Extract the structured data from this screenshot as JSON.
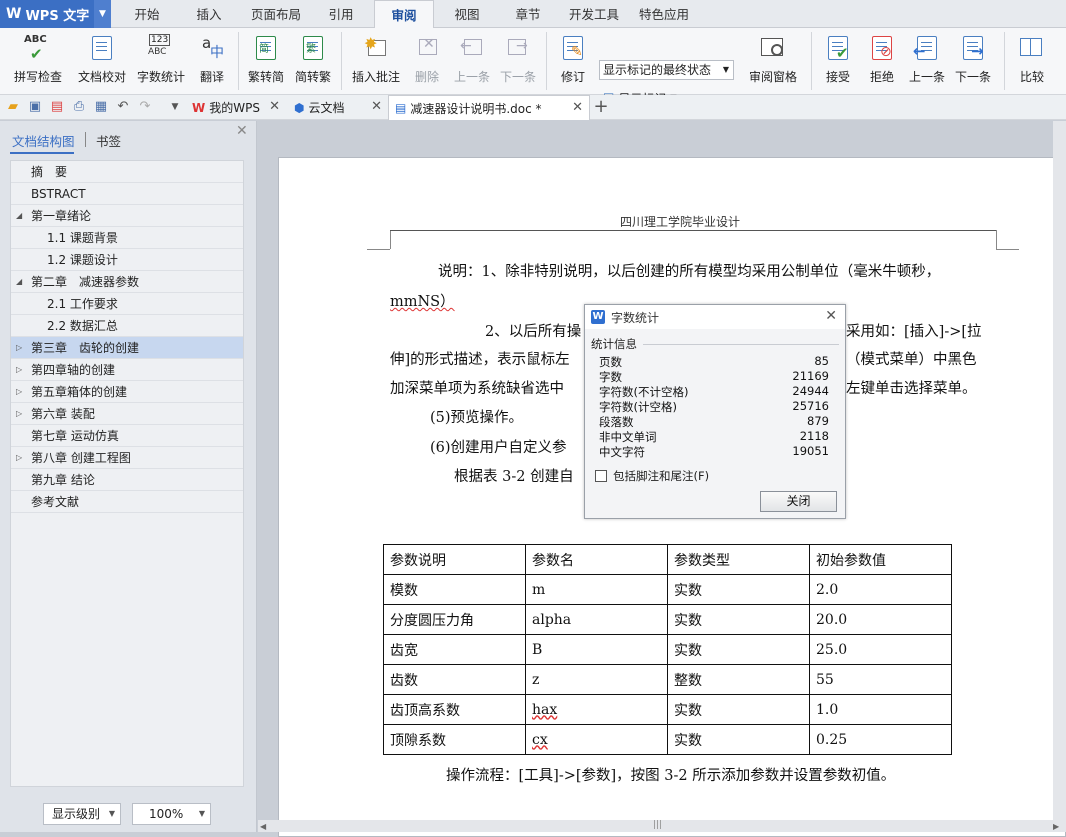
{
  "app": {
    "logo_text": "WPS 文字"
  },
  "menu_tabs": [
    "开始",
    "插入",
    "页面布局",
    "引用",
    "审阅",
    "视图",
    "章节",
    "开发工具",
    "特色应用"
  ],
  "active_tab": "审阅",
  "ribbon": {
    "spell": "拼写检查",
    "proof": "文档校对",
    "wordcount": "字数统计",
    "translate": "翻译",
    "to_simplified": "繁转简",
    "to_traditional": "简转繁",
    "insert_comment": "插入批注",
    "delete": "删除",
    "prev": "上一条",
    "next": "下一条",
    "revise": "修订",
    "markup_select": "显示标记的最终状态",
    "show_markup": "显示标记",
    "review_pane": "审阅窗格",
    "accept": "接受",
    "reject": "拒绝",
    "prev2": "上一条",
    "next2": "下一条",
    "compare": "比较"
  },
  "doc_tabs": [
    {
      "label": "我的WPS"
    },
    {
      "label": "云文档"
    },
    {
      "label": "减速器设计说明书.doc *"
    }
  ],
  "nav": {
    "tab_outline": "文档结构图",
    "tab_bookmark": "书签",
    "items": [
      "摘　要",
      "BSTRACT",
      "第一章绪论",
      "1.1 课题背景",
      "1.2 课题设计",
      "第二章　减速器参数",
      "2.1 工作要求",
      "2.2 数据汇总",
      "第三章　齿轮的创建",
      "第四章轴的创建",
      "第五章箱体的创建",
      "第六章 装配",
      "第七章 运动仿真",
      "第八章 创建工程图",
      "第九章 结论",
      "参考文献"
    ],
    "level_select": "显示级别",
    "zoom": "100%"
  },
  "page": {
    "header": "四川理工学院毕业设计",
    "para1a": "说明：1、除非特别说明，以后创建的所有模型均采用公制单位（毫米牛顿秒，",
    "para1b": "mmNS）",
    "para2a": "2、以后所有操",
    "para2a_right": "采用如：[插入]->[拉",
    "para2b_left": "伸]的形式描述，表示鼠标左",
    "para2b_right": "（模式菜单）中黑色",
    "para2c_left": "加深菜单项为系统缺省选中",
    "para2c_right": "左键单击选择菜单。",
    "item5": "(5)预览操作。",
    "item6": "(6)创建用户自定义参",
    "para3": "根据表 3-2 创建自",
    "table": [
      [
        "参数说明",
        "参数名",
        "参数类型",
        "初始参数值"
      ],
      [
        "模数",
        "m",
        "实数",
        "2.0"
      ],
      [
        "分度圆压力角",
        "alpha",
        "实数",
        "20.0"
      ],
      [
        "齿宽",
        "B",
        "实数",
        "25.0"
      ],
      [
        "齿数",
        "z",
        "整数",
        "55"
      ],
      [
        "齿顶高系数",
        "hax",
        "实数",
        "1.0"
      ],
      [
        "顶隙系数",
        "cx",
        "实数",
        "0.25"
      ]
    ],
    "footer_line": "操作流程：[工具]->[参数]，按图 3-2 所示添加参数并设置参数初值。"
  },
  "dialog": {
    "title": "字数统计",
    "group": "统计信息",
    "stats": [
      {
        "label": "页数",
        "value": "85"
      },
      {
        "label": "字数",
        "value": "21169"
      },
      {
        "label": "字符数(不计空格)",
        "value": "24944"
      },
      {
        "label": "字符数(计空格)",
        "value": "25716"
      },
      {
        "label": "段落数",
        "value": "879"
      },
      {
        "label": "非中文单词",
        "value": "2118"
      },
      {
        "label": "中文字符",
        "value": "19051"
      }
    ],
    "checkbox": "包括脚注和尾注(F)",
    "close": "关闭"
  }
}
